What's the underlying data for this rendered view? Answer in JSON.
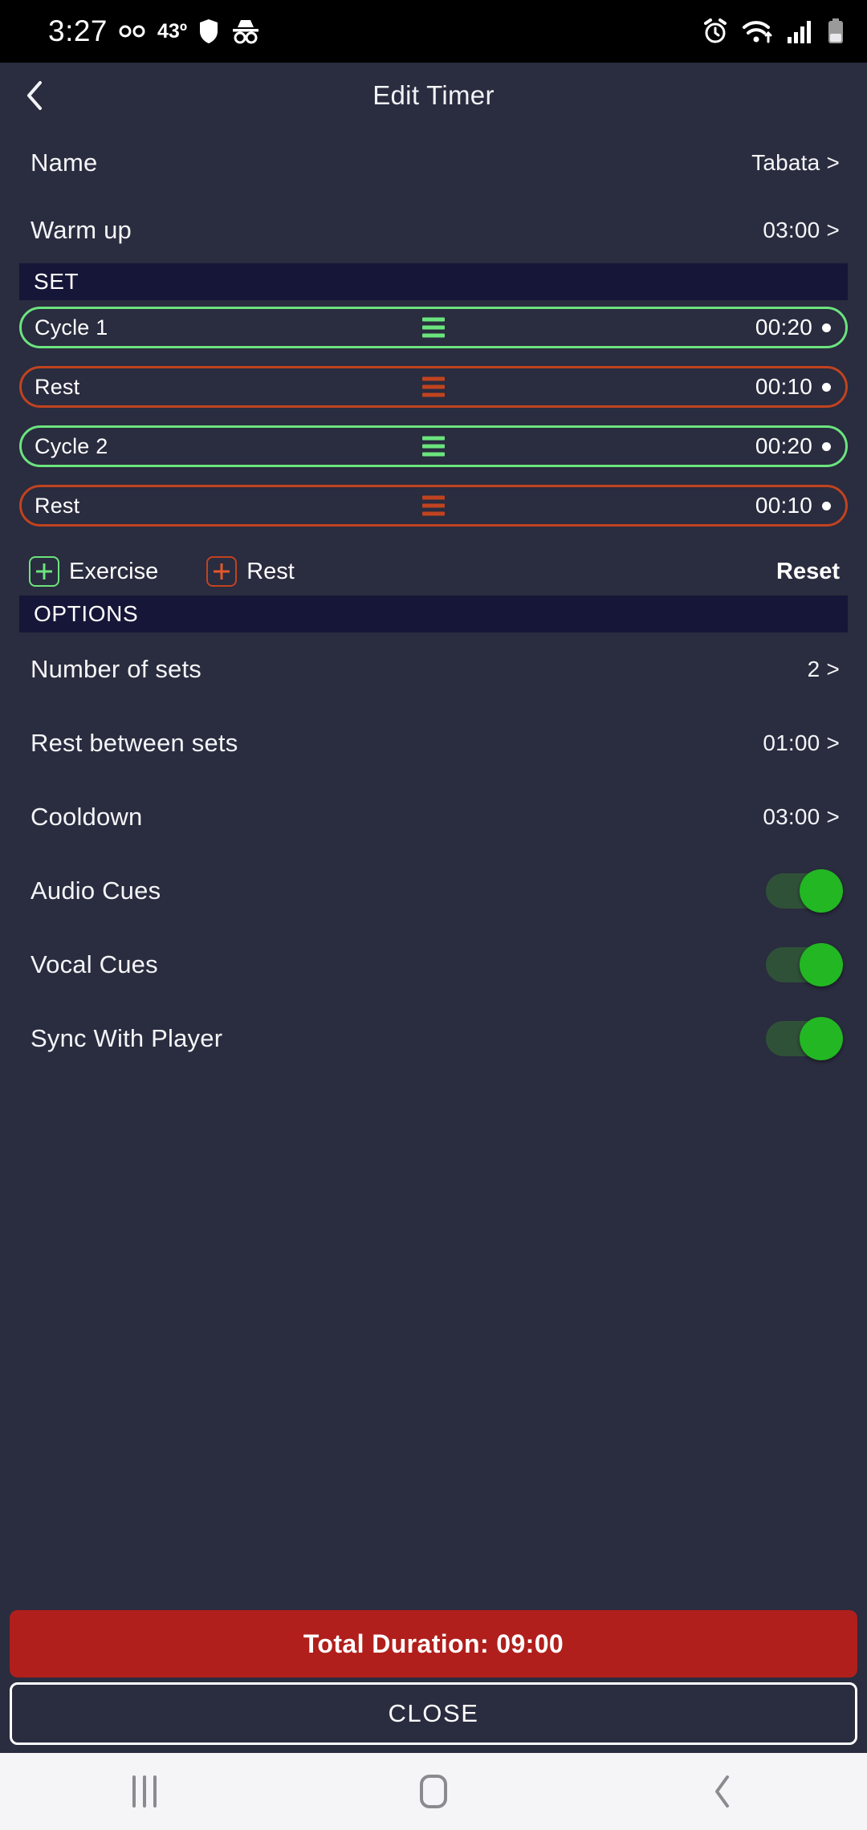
{
  "statusbar": {
    "time": "3:27",
    "temperature": "43º",
    "icons_left": [
      "voicemail-icon",
      "shield-icon",
      "incognito-icon"
    ],
    "icons_right": [
      "alarm-icon",
      "wifi-icon",
      "signal-icon",
      "battery-icon"
    ]
  },
  "header": {
    "back_icon": "back-chevron-icon",
    "title": "Edit Timer"
  },
  "rows": {
    "name": {
      "label": "Name",
      "value": "Tabata",
      "chevron": ">"
    },
    "warmup": {
      "label": "Warm up",
      "value": "03:00",
      "chevron": ">"
    }
  },
  "set_section": {
    "header": "SET",
    "items": [
      {
        "name": "Cycle 1",
        "time": "00:20",
        "kind": "exercise"
      },
      {
        "name": "Rest",
        "time": "00:10",
        "kind": "rest"
      },
      {
        "name": "Cycle 2",
        "time": "00:20",
        "kind": "exercise"
      },
      {
        "name": "Rest",
        "time": "00:10",
        "kind": "rest"
      }
    ],
    "add_exercise_label": "Exercise",
    "add_rest_label": "Rest",
    "reset_label": "Reset"
  },
  "options_section": {
    "header": "OPTIONS",
    "rows": [
      {
        "label": "Number of sets",
        "value": "2",
        "chevron": ">"
      },
      {
        "label": "Rest between sets",
        "value": "01:00",
        "chevron": ">"
      },
      {
        "label": "Cooldown",
        "value": "03:00",
        "chevron": ">"
      }
    ],
    "toggles": [
      {
        "label": "Audio Cues",
        "state": "on"
      },
      {
        "label": "Vocal Cues",
        "state": "on"
      },
      {
        "label": "Sync With Player",
        "state": "on"
      }
    ]
  },
  "footer": {
    "duration_label": "Total Duration: 09:00",
    "close_label": "CLOSE"
  },
  "navbar": {
    "recents": "recents-icon",
    "home": "home-icon",
    "back": "back-icon"
  },
  "colors": {
    "background": "#2a2c3f",
    "section_header_bg": "#161638",
    "exercise_accent": "#6be47e",
    "rest_accent": "#c0431f",
    "toggle_on": "#22b723",
    "duration_bar": "#b01f1c"
  }
}
